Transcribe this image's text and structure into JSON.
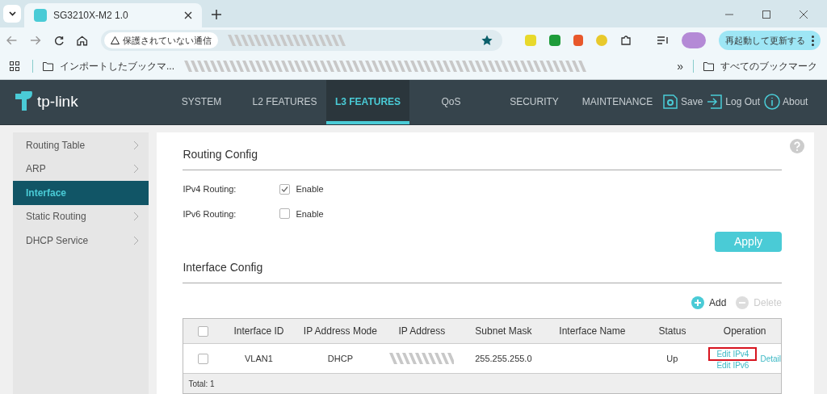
{
  "browser": {
    "tab_title": "SG3210X-M2 1.0",
    "security_label": "保護されていない通信",
    "update_button": "再起動して更新する",
    "bookmarks": [
      {
        "label": "インポートしたブックマ..."
      }
    ],
    "all_bookmarks": "すべてのブックマーク",
    "overflow": "»"
  },
  "header": {
    "logo": "tp-link",
    "nav": [
      {
        "label": "SYSTEM",
        "selected": false
      },
      {
        "label": "L2 FEATURES",
        "selected": false
      },
      {
        "label": "L3 FEATURES",
        "selected": true
      },
      {
        "label": "QoS",
        "selected": false
      },
      {
        "label": "SECURITY",
        "selected": false
      },
      {
        "label": "MAINTENANCE",
        "selected": false
      }
    ],
    "actions": [
      {
        "kind": "save",
        "label": "Save"
      },
      {
        "kind": "logout",
        "label": "Log Out"
      },
      {
        "kind": "about",
        "label": "About"
      }
    ]
  },
  "sidebar": {
    "items": [
      {
        "label": "Routing Table",
        "selected": false
      },
      {
        "label": "ARP",
        "selected": false
      },
      {
        "label": "Interface",
        "selected": true
      },
      {
        "label": "Static Routing",
        "selected": false
      },
      {
        "label": "DHCP Service",
        "selected": false
      }
    ]
  },
  "routing_config": {
    "title": "Routing Config",
    "options": [
      {
        "label": "IPv4 Routing:",
        "checkbox_label": "Enable",
        "checked": true
      },
      {
        "label": "IPv6 Routing:",
        "checkbox_label": "Enable",
        "checked": false
      }
    ],
    "apply": "Apply"
  },
  "interface_config": {
    "title": "Interface Config",
    "add": "Add",
    "delete": "Delete",
    "table": {
      "select_all_checked": false,
      "columns": [
        "Interface ID",
        "IP Address Mode",
        "IP Address",
        "Subnet Mask",
        "Interface Name",
        "Status",
        "Operation"
      ],
      "rows": [
        {
          "checked": false,
          "interface_id": "VLAN1",
          "mode": "DHCP",
          "subnet": "255.255.255.0",
          "status": "Up",
          "operations": [
            "Edit IPv4",
            "Edit IPv6",
            "Detail"
          ]
        }
      ],
      "footer": "Total: 1"
    }
  }
}
